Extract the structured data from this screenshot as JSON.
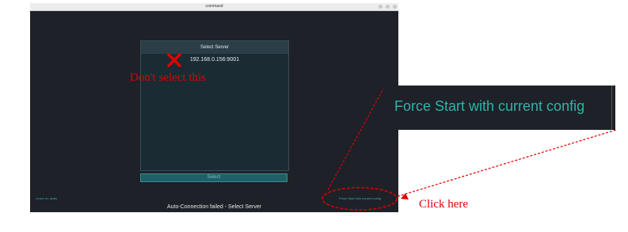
{
  "window": {
    "title": "command"
  },
  "dialog": {
    "header": "Select Server",
    "servers": [
      "192.168.0.156:9001"
    ],
    "select_label": "Select"
  },
  "footer": {
    "left_link": "Leave on deals",
    "right_link": "Force Start with current config",
    "status": "Auto-Connection failed - Select Server"
  },
  "zoom": {
    "label": "Force Start with current config"
  },
  "annotations": {
    "dont_select": "Don't select this",
    "click_here": "Click here"
  },
  "colors": {
    "annotation": "#e00000",
    "accent": "#2fb3a8"
  }
}
